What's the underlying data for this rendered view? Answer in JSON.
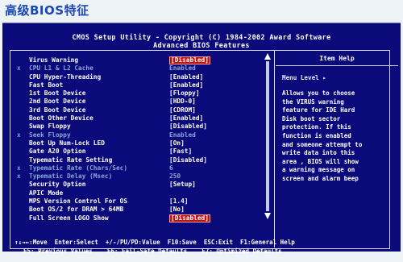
{
  "page_title": "高级BIOS特征",
  "header": {
    "line1": "CMOS Setup Utility - Copyright (C) 1984-2002 Award Software",
    "line2": "Advanced BIOS Features"
  },
  "settings": [
    {
      "marker": "",
      "label": "Virus Warning",
      "value": "[Disabled]",
      "state": "selected"
    },
    {
      "marker": "x",
      "label": "CPU L1 & L2 Cache",
      "value": "Enabled",
      "state": "disabled"
    },
    {
      "marker": "",
      "label": "CPU Hyper-Threading",
      "value": "[Enabled]",
      "state": "normal"
    },
    {
      "marker": "",
      "label": "Fast Boot",
      "value": "[Enabled]",
      "state": "normal"
    },
    {
      "marker": "",
      "label": "1st Boot Device",
      "value": "[Floppy]",
      "state": "normal"
    },
    {
      "marker": "",
      "label": "2nd Boot Device",
      "value": "[HDD-0]",
      "state": "normal"
    },
    {
      "marker": "",
      "label": "3rd Boot Device",
      "value": "[CDROM]",
      "state": "normal"
    },
    {
      "marker": "",
      "label": "Boot Other Device",
      "value": "[Enabled]",
      "state": "normal"
    },
    {
      "marker": "",
      "label": "Swap Floppy",
      "value": "[Disabled]",
      "state": "normal"
    },
    {
      "marker": "x",
      "label": "Seek Floppy",
      "value": "Enabled",
      "state": "disabled"
    },
    {
      "marker": "",
      "label": "Boot Up Num-Lock LED",
      "value": "[On]",
      "state": "normal"
    },
    {
      "marker": "",
      "label": "Gate A20 Option",
      "value": "[Fast]",
      "state": "normal"
    },
    {
      "marker": "",
      "label": "Typematic Rate Setting",
      "value": "[Disabled]",
      "state": "normal"
    },
    {
      "marker": "x",
      "label": "Typematic Rate (Chars/Sec)",
      "value": "6",
      "state": "disabled"
    },
    {
      "marker": "x",
      "label": "Typematic Delay (Msec)",
      "value": "250",
      "state": "disabled"
    },
    {
      "marker": "",
      "label": "Security Option",
      "value": "[Setup]",
      "state": "normal"
    },
    {
      "marker": "",
      "label": "APIC Mode",
      "value": "",
      "state": "normal"
    },
    {
      "marker": "",
      "label": "MPS Version Control For OS",
      "value": "[1.4]",
      "state": "normal"
    },
    {
      "marker": "",
      "label": "Boot OS/2 for DRAM > 64MB",
      "value": "[No]",
      "state": "normal"
    },
    {
      "marker": "",
      "label": "Full Screen LOGO Show",
      "value": "[Disabled]",
      "state": "selected"
    }
  ],
  "help": {
    "title": "Item Help",
    "menu_level": "Menu Level   ▸",
    "text": "Allows you to choose\nthe VIRUS warning\nfeature for IDE Hard\nDisk boot sector\nprotection. If this\nfunction is enabled\nand someone attempt to\nwrite data into this\narea , BIOS will show\na warning message on\nscreen and alarm beep"
  },
  "footer": {
    "row1": [
      "↑↓→←:Move",
      "Enter:Select",
      "+/-/PU/PD:Value",
      "F10:Save",
      "ESC:Exit",
      "F1:General Help"
    ],
    "row2": [
      "F5: Previous Values",
      "F6: Fail-Safe Defaults",
      "F7: Optimized Defaults"
    ]
  },
  "colors": {
    "screen_bg": "#0a0a7a",
    "selected_bg": "#c60c0c",
    "disabled_text": "#8aa6d8",
    "title_color": "#1a47b3"
  }
}
